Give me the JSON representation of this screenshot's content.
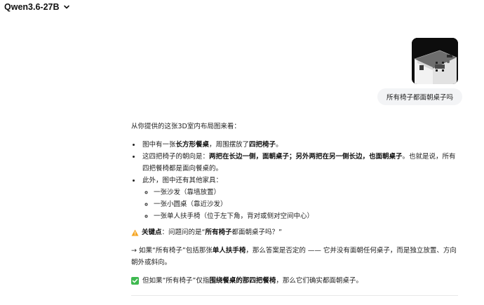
{
  "header": {
    "model_name": "Qwen3.6-27B"
  },
  "chat": {
    "user_message": "所有椅子都面朝桌子吗",
    "user_image_alt": "3D室内布局图"
  },
  "answer": {
    "intro": "从你提供的这张3D室内布局图来看：",
    "bullet1": {
      "prefix": "图中有一张",
      "bold1": "长方形餐桌",
      "mid": "，周围摆放了",
      "bold2": "四把椅子",
      "suffix": "。"
    },
    "bullet2": {
      "prefix": "这四把椅子的朝向是：",
      "bold": "两把在长边一侧，面朝桌子；另外两把在另一侧长边，也面朝桌子",
      "suffix": "。也就是说，所有四把餐椅都是面向餐桌的。"
    },
    "bullet3": {
      "text": "此外，图中还有其他家具：",
      "sub": [
        "一张沙发（靠墙放置）",
        "一张小圆桌（靠近沙发）",
        "一张单人扶手椅（位于左下角，背对或侧对空间中心）"
      ]
    },
    "key_point": {
      "label": "关键点",
      "prefix": "：问题问的是“",
      "bold": "所有椅子",
      "suffix": "都面朝桌子吗？”"
    },
    "arrow_line": {
      "prefix": "→ 如果“所有椅子”包括那张",
      "bold": "单人扶手椅",
      "suffix": "，那么答案是否定的 —— 它并没有面朝任何桌子，而是独立放置、方向朝外或斜向。"
    },
    "check_line": {
      "prefix": "但如果“所有椅子”仅指",
      "bold": "围绕餐桌的那四把餐椅",
      "suffix": "，那么它们确实都面朝桌子。"
    }
  },
  "icons": {
    "model_dropdown": "chevron-down-icon",
    "key_point": "warning-icon",
    "check": "check-box-icon"
  },
  "colors": {
    "warning": "#f5a623",
    "check": "#3fb950",
    "user_bubble": "#f3f4f6"
  }
}
